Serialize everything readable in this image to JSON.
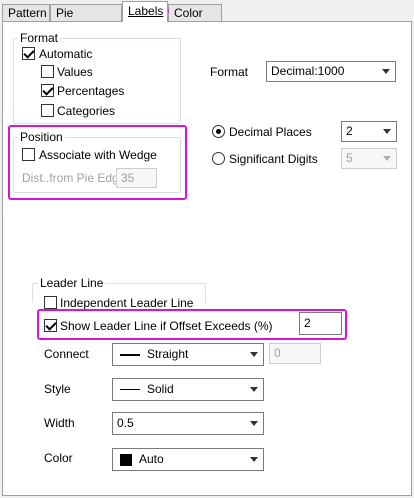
{
  "tabs": [
    {
      "label": "Pattern"
    },
    {
      "label": "Pie Geometry"
    },
    {
      "label": "Labels"
    },
    {
      "label": "Color List"
    }
  ],
  "format_group": {
    "title": "Format",
    "automatic": {
      "label": "Automatic",
      "checked": true
    },
    "values": {
      "label": "Values",
      "checked": false
    },
    "percentages": {
      "label": "Percentages",
      "checked": true
    },
    "categories": {
      "label": "Categories",
      "checked": false
    }
  },
  "position_group": {
    "title": "Position",
    "associate": {
      "label": "Associate with Wedge",
      "checked": false
    },
    "dist_label": "Dist..from Pie Edge",
    "dist_value": "35"
  },
  "format_select": {
    "label": "Format",
    "value": "Decimal:1000"
  },
  "decimal_places": {
    "label": "Decimal Places",
    "value": "2",
    "selected": true
  },
  "significant_digits": {
    "label": "Significant Digits",
    "value": "5",
    "selected": false
  },
  "leader_line": {
    "title": "Leader Line",
    "independent": {
      "label": "Independent Leader Line",
      "checked": false
    },
    "show_offset": {
      "label": "Show Leader Line if Offset Exceeds (%)",
      "checked": true,
      "value": "2"
    },
    "connect": {
      "label": "Connect",
      "value": "Straight",
      "extra_value": "0"
    },
    "style": {
      "label": "Style",
      "value": "Solid"
    },
    "width": {
      "label": "Width",
      "value": "0.5"
    },
    "color": {
      "label": "Color",
      "value": "Auto",
      "swatch": "#000000"
    }
  },
  "colors": {
    "highlight": "#d416d4",
    "border": "#a0a0a0"
  }
}
